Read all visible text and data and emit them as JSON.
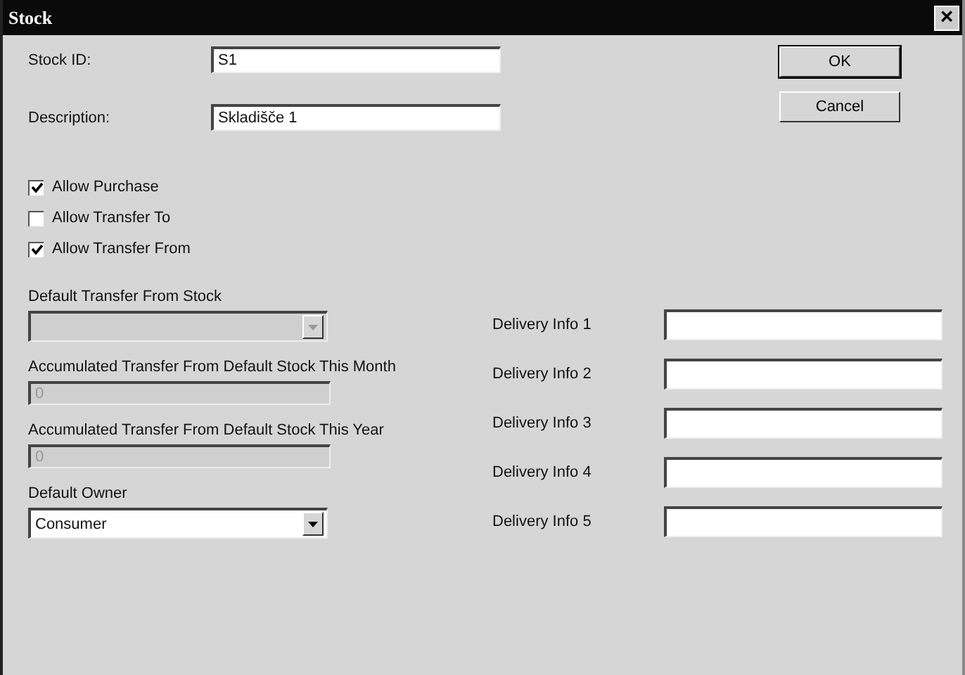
{
  "window": {
    "title": "Stock",
    "close": "×"
  },
  "header_fields": [
    {
      "label": "Stock ID:",
      "value": "S1"
    },
    {
      "label": "Description:",
      "value": "Skladišče 1"
    }
  ],
  "buttons": [
    {
      "label": "OK",
      "default": true
    },
    {
      "label": "Cancel",
      "default": false
    }
  ],
  "checkboxes": [
    {
      "label": "Allow Purchase",
      "checked": true
    },
    {
      "label": "Allow Transfer To",
      "checked": false
    },
    {
      "label": "Allow Transfer From",
      "checked": true
    }
  ],
  "left_fields": [
    {
      "kind": "combo",
      "label": "Default Transfer From Stock",
      "disabled": true
    },
    {
      "kind": "text",
      "label": "Accumulated Transfer From Default Stock This Month",
      "value": "0",
      "disabled": true
    },
    {
      "kind": "text",
      "label": "Accumulated Transfer From Default Stock This Year",
      "value": "0",
      "disabled": true
    },
    {
      "kind": "combo",
      "label": "Default Owner",
      "value": "Consumer",
      "disabled": false
    }
  ],
  "delivery_fields": [
    {
      "label": "Delivery Info 1"
    },
    {
      "label": "Delivery Info 2"
    },
    {
      "label": "Delivery Info 3"
    },
    {
      "label": "Delivery Info 4"
    },
    {
      "label": "Delivery Info 5"
    }
  ]
}
